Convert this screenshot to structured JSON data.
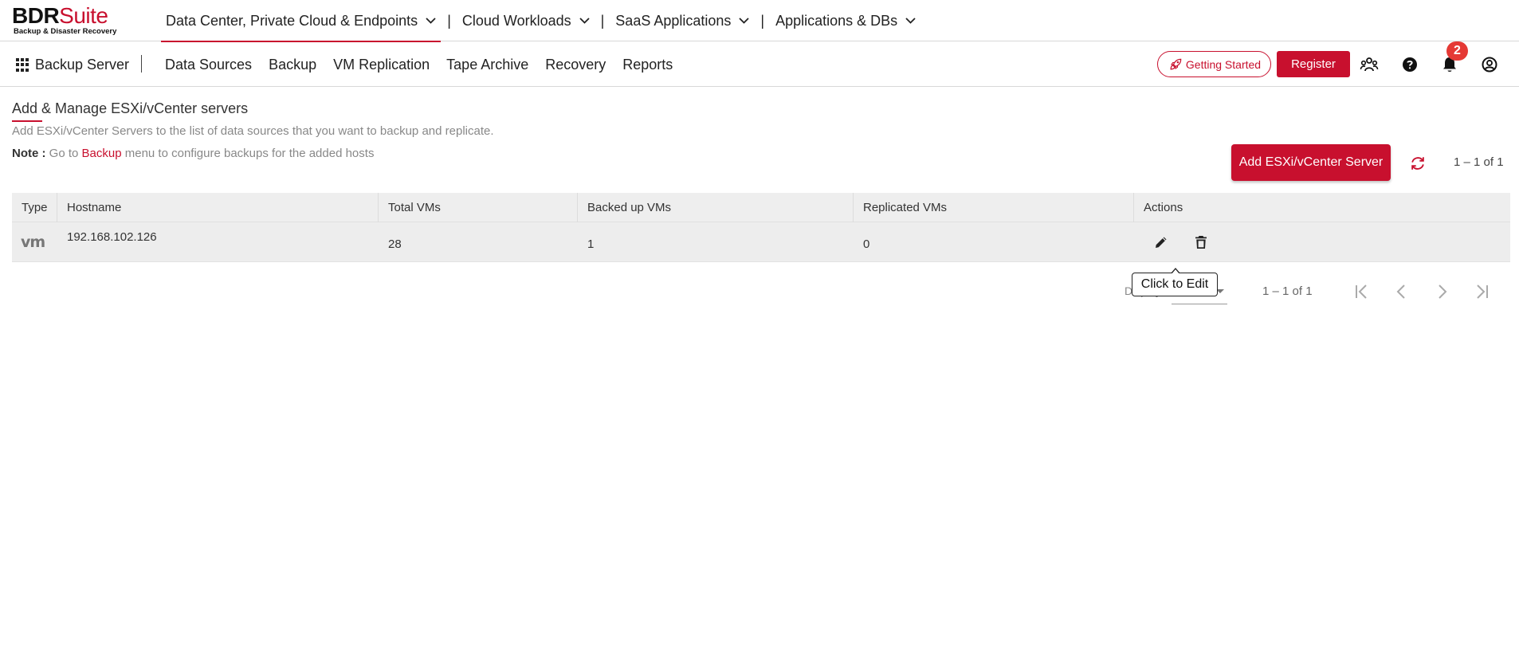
{
  "brand": {
    "name_bold": "BDR",
    "name_light": "Suite",
    "tagline": "Backup & Disaster Recovery",
    "accent": "#c8102e"
  },
  "product_tabs": [
    {
      "label": "Data Center, Private Cloud & Endpoints",
      "active": true
    },
    {
      "label": "Cloud Workloads",
      "active": false
    },
    {
      "label": "SaaS Applications",
      "active": false
    },
    {
      "label": "Applications & DBs",
      "active": false
    }
  ],
  "nav": {
    "app_label": "Backup Server",
    "links": [
      "Data Sources",
      "Backup",
      "VM Replication",
      "Tape Archive",
      "Recovery",
      "Reports"
    ],
    "getting_started": "Getting Started",
    "register": "Register",
    "notification_count": "2",
    "icons": [
      "users-icon",
      "help-icon",
      "bell-icon",
      "account-icon"
    ]
  },
  "page": {
    "title": "Add & Manage ESXi/vCenter servers",
    "subtitle": "Add ESXi/vCenter Servers to the list of data sources that you want to backup and replicate.",
    "note_label": "Note :",
    "note_pre": " Go to ",
    "note_link": "Backup",
    "note_post": " menu to configure backups for the added hosts",
    "add_button": "Add ESXi/vCenter Server",
    "range_top": "1 – 1 of 1"
  },
  "table": {
    "columns": [
      "Type",
      "Hostname",
      "Total VMs",
      "Backed up VMs",
      "Replicated VMs",
      "Actions"
    ],
    "rows": [
      {
        "type": "vm",
        "hostname": "192.168.102.126",
        "total_vms": "28",
        "backed_up_vms": "1",
        "replicated_vms": "0"
      }
    ]
  },
  "tooltip": "Click to Edit",
  "paginator": {
    "label": "Display",
    "page_size": "10",
    "range": "1 – 1 of 1"
  }
}
